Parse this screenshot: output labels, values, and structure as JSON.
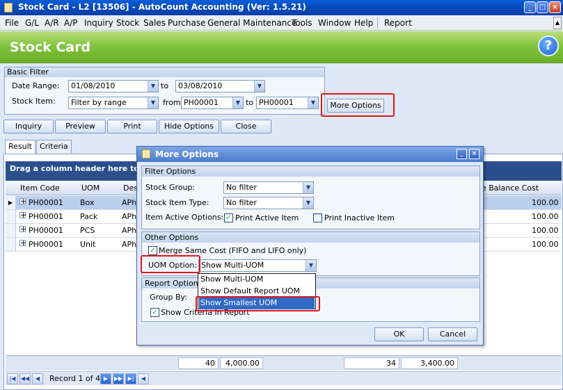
{
  "window": {
    "title": "Stock Card - L2 [13506] - AutoCount Accounting (Ver: 1.5.21)",
    "min": "_",
    "max": "□",
    "close": "×"
  },
  "menu": {
    "items": [
      "File",
      "G/L",
      "A/R",
      "A/P",
      "Inquiry",
      "Stock",
      "Sales",
      "Purchase",
      "General Maintenance",
      "Tools",
      "Window",
      "Help"
    ],
    "report": "Report"
  },
  "header": {
    "title": "Stock Card",
    "help": "?"
  },
  "basic_filter": {
    "title": "Basic Filter",
    "date_range_label": "Date Range:",
    "date_from": "01/08/2010",
    "to1": "to",
    "date_to": "03/08/2010",
    "stock_item_label": "Stock Item:",
    "stock_item_value": "Filter by range",
    "from": "from",
    "item_from": "PH00001",
    "to2": "to",
    "item_to": "PH00001",
    "more_options": "More Options"
  },
  "toolbar": {
    "inquiry": "Inquiry",
    "preview": "Preview",
    "print": "Print",
    "hide_options": "Hide Options",
    "close": "Close"
  },
  "tabs": {
    "result": "Result",
    "criteria": "Criteria"
  },
  "grid": {
    "group_hint": "Drag a column header here to gr",
    "col_item_code": "Item Code",
    "col_uom": "UOM",
    "col_desc": "Des",
    "col_balance_cost": "ge Balance Cost",
    "rows": [
      {
        "item": "PH00001",
        "uom": "Box",
        "desc": "APh",
        "cost": "100.00"
      },
      {
        "item": "PH00001",
        "uom": "Pack",
        "desc": "APh",
        "cost": "100.00"
      },
      {
        "item": "PH00001",
        "uom": "PCS",
        "desc": "APh",
        "cost": "100.00"
      },
      {
        "item": "PH00001",
        "uom": "Unit",
        "desc": "APh",
        "cost": "100.00"
      }
    ],
    "footer": [
      "40",
      "4,000.00",
      "34",
      "3,400.00"
    ],
    "record_text": "Record 1 of 4"
  },
  "dialog": {
    "title": "More Options",
    "filter_options": "Filter Options",
    "stock_group_label": "Stock Group:",
    "stock_group_value": "No filter",
    "stock_item_type_label": "Stock Item Type:",
    "stock_item_type_value": "No filter",
    "item_active_label": "Item Active Options:",
    "print_active": "Print Active Item",
    "print_inactive": "Print Inactive Item",
    "other_options": "Other Options",
    "merge_same_cost": "Merge Same Cost (FIFO and LIFO only)",
    "uom_option_label": "UOM Option:",
    "uom_option_value": "Show Multi-UOM",
    "report_options": "Report Options",
    "group_by_label": "Group By:",
    "show_criteria": "Show Criteria In Report",
    "ok": "OK",
    "cancel": "Cancel",
    "dropdown_options": [
      "Show Multi-UOM",
      "Show Default Report UOM",
      "Show Smallest UOM"
    ],
    "dropdown_selected_index": 2
  },
  "colors": {
    "header_green": "#7fc23c",
    "title_blue": "#0848b8",
    "highlight_red": "#e0141c",
    "selection_blue": "#316ac5"
  }
}
